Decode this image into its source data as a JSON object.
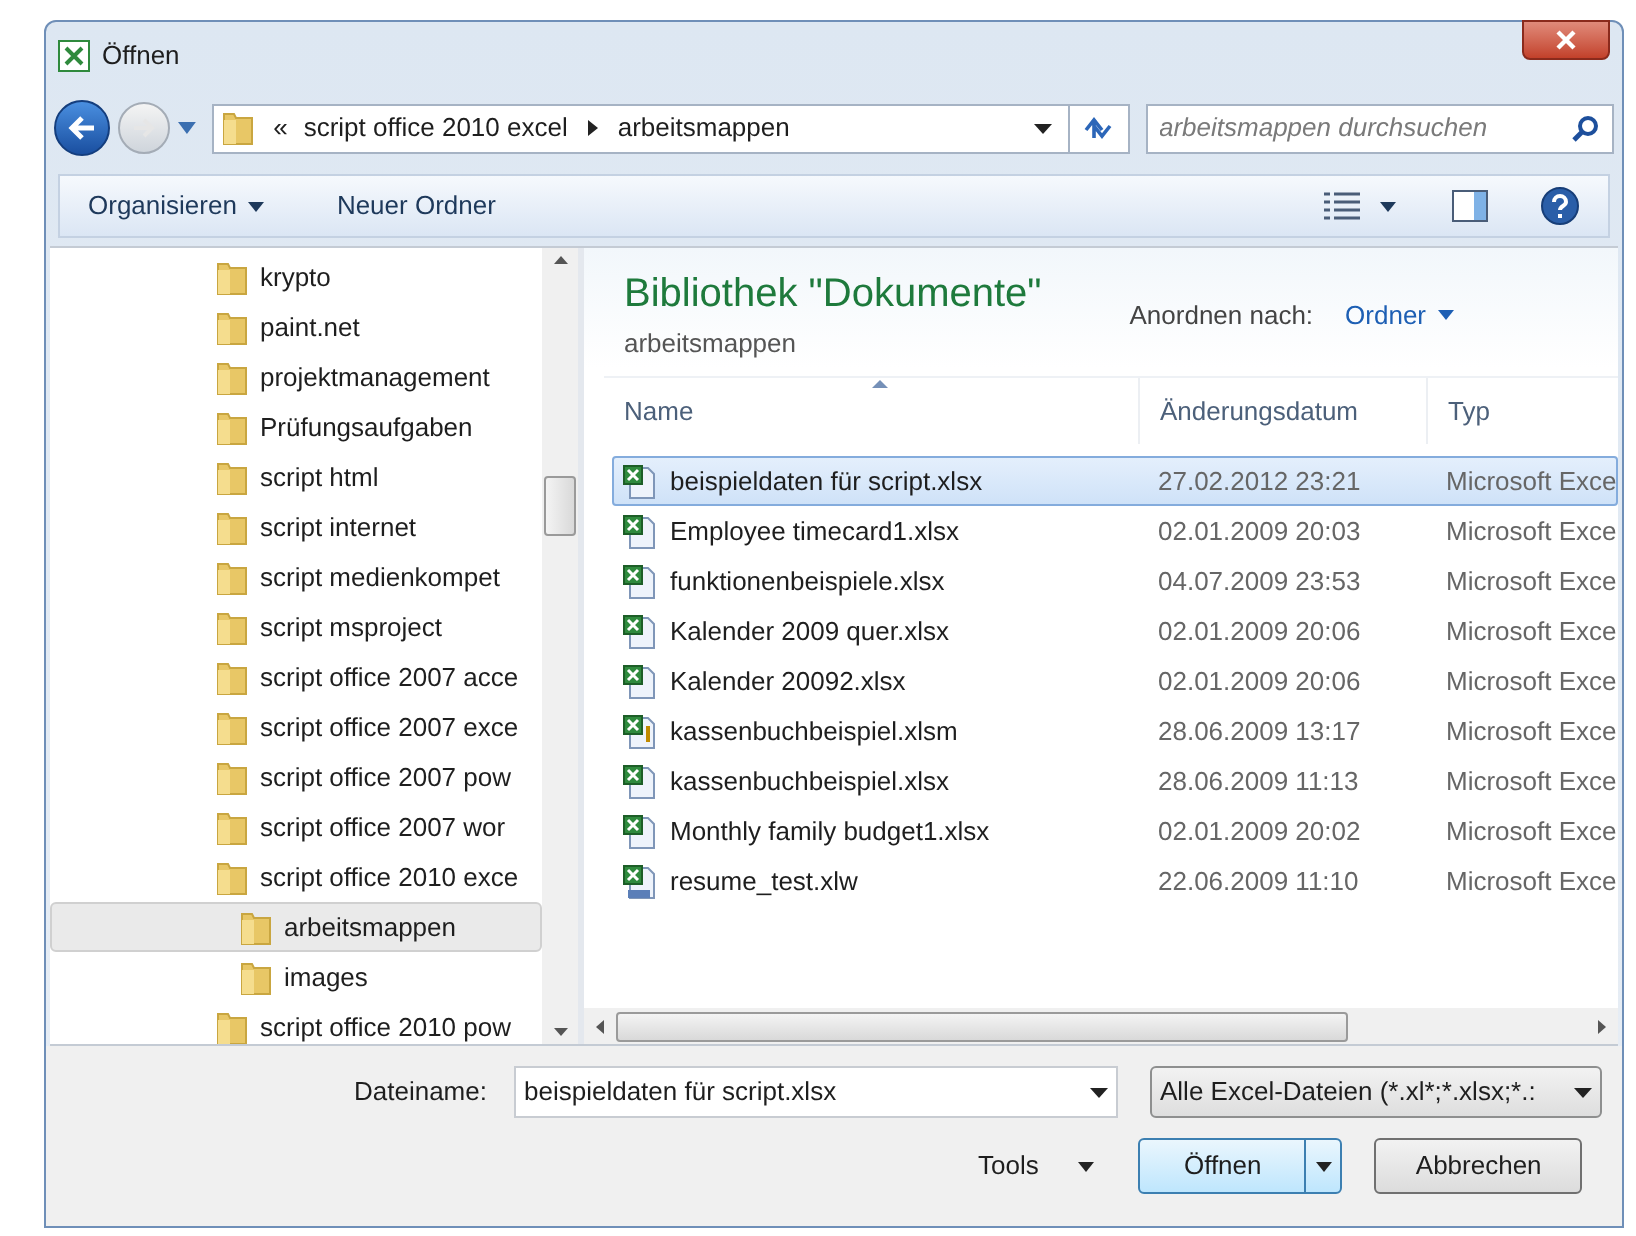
{
  "window": {
    "title": "Öffnen"
  },
  "address": {
    "overflow": "«",
    "segments": [
      "script office 2010 excel",
      "arbeitsmappen"
    ]
  },
  "search": {
    "placeholder": "arbeitsmappen durchsuchen"
  },
  "toolbar": {
    "organize": "Organisieren",
    "new_folder": "Neuer Ordner"
  },
  "tree": [
    {
      "label": "krypto",
      "selected": false
    },
    {
      "label": "paint.net",
      "selected": false
    },
    {
      "label": "projektmanagement",
      "selected": false
    },
    {
      "label": "Prüfungsaufgaben",
      "selected": false
    },
    {
      "label": "script html",
      "selected": false
    },
    {
      "label": "script internet",
      "selected": false
    },
    {
      "label": "script medienkompet",
      "selected": false
    },
    {
      "label": "script msproject",
      "selected": false
    },
    {
      "label": "script office 2007 acce",
      "selected": false
    },
    {
      "label": "script office 2007 exce",
      "selected": false
    },
    {
      "label": "script office 2007 pow",
      "selected": false
    },
    {
      "label": "script office 2007 wor",
      "selected": false
    },
    {
      "label": "script office 2010 exce",
      "selected": false,
      "children": [
        {
          "label": "arbeitsmappen",
          "selected": true
        },
        {
          "label": "images",
          "selected": false
        }
      ]
    },
    {
      "label": "script office 2010 pow",
      "selected": false
    }
  ],
  "library": {
    "title": "Bibliothek \"Dokumente\"",
    "subtitle": "arbeitsmappen",
    "arrange_label": "Anordnen nach:",
    "arrange_value": "Ordner"
  },
  "columns": [
    {
      "label": "Name",
      "sorted": true
    },
    {
      "label": "Änderungsdatum",
      "sorted": false
    },
    {
      "label": "Typ",
      "sorted": false
    }
  ],
  "files": [
    {
      "name": "beispieldaten für script.xlsx",
      "date": "27.02.2012 23:21",
      "type": "Microsoft Exce",
      "kind": "xlsx",
      "selected": true
    },
    {
      "name": "Employee timecard1.xlsx",
      "date": "02.01.2009 20:03",
      "type": "Microsoft Exce",
      "kind": "xlsx",
      "selected": false
    },
    {
      "name": "funktionenbeispiele.xlsx",
      "date": "04.07.2009 23:53",
      "type": "Microsoft Exce",
      "kind": "xlsx",
      "selected": false
    },
    {
      "name": "Kalender 2009 quer.xlsx",
      "date": "02.01.2009 20:06",
      "type": "Microsoft Exce",
      "kind": "xlsx",
      "selected": false
    },
    {
      "name": "Kalender 20092.xlsx",
      "date": "02.01.2009 20:06",
      "type": "Microsoft Exce",
      "kind": "xlsx",
      "selected": false
    },
    {
      "name": "kassenbuchbeispiel.xlsm",
      "date": "28.06.2009 13:17",
      "type": "Microsoft Exce",
      "kind": "xlsm",
      "selected": false
    },
    {
      "name": "kassenbuchbeispiel.xlsx",
      "date": "28.06.2009 11:13",
      "type": "Microsoft Exce",
      "kind": "xlsx",
      "selected": false
    },
    {
      "name": "Monthly family budget1.xlsx",
      "date": "02.01.2009 20:02",
      "type": "Microsoft Exce",
      "kind": "xlsx",
      "selected": false
    },
    {
      "name": "resume_test.xlw",
      "date": "22.06.2009 11:10",
      "type": "Microsoft Exce",
      "kind": "xlw",
      "selected": false
    }
  ],
  "filename": {
    "label": "Dateiname:",
    "value": "beispieldaten für script.xlsx"
  },
  "filetype": "Alle Excel-Dateien (*.xl*;*.xlsx;*.:",
  "tools": "Tools",
  "buttons": {
    "open": "Öffnen",
    "cancel": "Abbrechen"
  }
}
